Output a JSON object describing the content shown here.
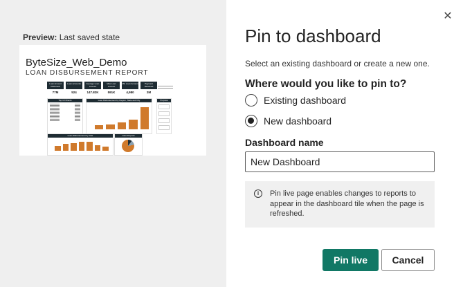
{
  "preview": {
    "caption_bold": "Preview:",
    "caption_text": "Last saved state",
    "thumbnail": {
      "title": "ByteSize_Web_Demo",
      "subtitle": "LOAN DISBURSEMENT REPORT",
      "kpis": [
        {
          "label": "Loan Amount Disbursed",
          "value": "77M"
        },
        {
          "label": "Loan Accounts",
          "value": "524"
        },
        {
          "label": "Average Loan Amount",
          "value": "147.82K"
        },
        {
          "label": "Max Loan Amount",
          "value": "591K"
        },
        {
          "label": "Min Loan Amount",
          "value": "4,980"
        },
        {
          "label": "Payment Received",
          "value": "2M"
        }
      ],
      "panels": {
        "clients": "Top 10 Clients",
        "region": "Loan Disbursement by Region, State and City",
        "purpose": "Purpose",
        "year": "Loan Disbursement by Year",
        "loan_purpose": "Loan Purpose"
      },
      "purpose_buttons": [
        "",
        "",
        "",
        ""
      ],
      "client_rows": [
        "",
        "",
        "",
        "",
        "",
        "",
        "",
        "",
        "",
        "",
        "",
        "",
        ""
      ],
      "region_bars": [
        0.18,
        0.2,
        0.28,
        0.4,
        0.9
      ],
      "year_bars": [
        0.5,
        0.7,
        0.8,
        0.95,
        0.9,
        0.55,
        0.4
      ]
    }
  },
  "dialog": {
    "title": "Pin to dashboard",
    "description": "Select an existing dashboard or create a new one.",
    "question": "Where would you like to pin to?",
    "options": [
      {
        "label": "Existing dashboard",
        "checked": false
      },
      {
        "label": "New dashboard",
        "checked": true
      }
    ],
    "name_label": "Dashboard name",
    "name_value": "New Dashboard",
    "info_text": "Pin live page enables changes to reports to appear in the dashboard tile when the page is refreshed.",
    "primary_button": "Pin live",
    "cancel_button": "Cancel",
    "close_glyph": "✕"
  },
  "colors": {
    "primary": "#117865",
    "bar": "#d07a2c",
    "header": "#1e2c33"
  }
}
